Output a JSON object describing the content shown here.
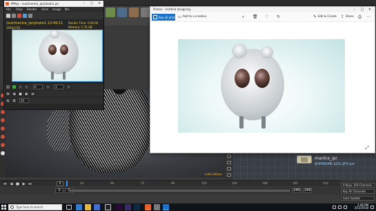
{
  "mplay": {
    "title": "MPlay - /out/mantra_ipr/photo1.pic",
    "menu": [
      "File",
      "View",
      "Render",
      "Anim",
      "Image",
      "Mo"
    ],
    "path": "/out/mantra_ipr/photo1 13:49:11",
    "subpath": "1044x720",
    "render_time": "Render Time: 0:00:00",
    "memory": "Memory: 1.76 GB",
    "frame_field": "1",
    "frame_field2": "0",
    "frame_field3": "24"
  },
  "photos": {
    "title": "Photos - Untitled designing",
    "see_all_label": "See all photos",
    "add_to_creation_label": "Add to a creation",
    "edit_create_label": "Edit & Create",
    "share_label": "Share",
    "icons": [
      "zoom-icon",
      "delete-icon",
      "heart-icon",
      "rotate-icon",
      "share-icon",
      "print-icon",
      "more-icon",
      "expand-icon"
    ]
  },
  "viewport": {
    "watermark": "Indie Edition"
  },
  "network": {
    "node_name": "mantra_ipr",
    "node_file": "$HIPNAME.$OS.$F4.exr"
  },
  "timeline": {
    "frame": "1",
    "ticks": [
      "24",
      "48",
      "72",
      "96",
      "120",
      "144",
      "168",
      "192",
      "216"
    ],
    "range_start": "1",
    "range_start2": "1",
    "range_end": "240",
    "range_end2": "240",
    "buttons": [
      "⏮",
      "◀",
      "■",
      "▶",
      "⏭"
    ]
  },
  "right_panel": {
    "opt1": "0 Keys, 0/0 Channels",
    "opt2": "Key All Channels",
    "opt3": "Auto Update"
  },
  "taskbar": {
    "search_placeholder": "Type here to search",
    "time": "1:06 PM",
    "date": "3/13/2018"
  }
}
